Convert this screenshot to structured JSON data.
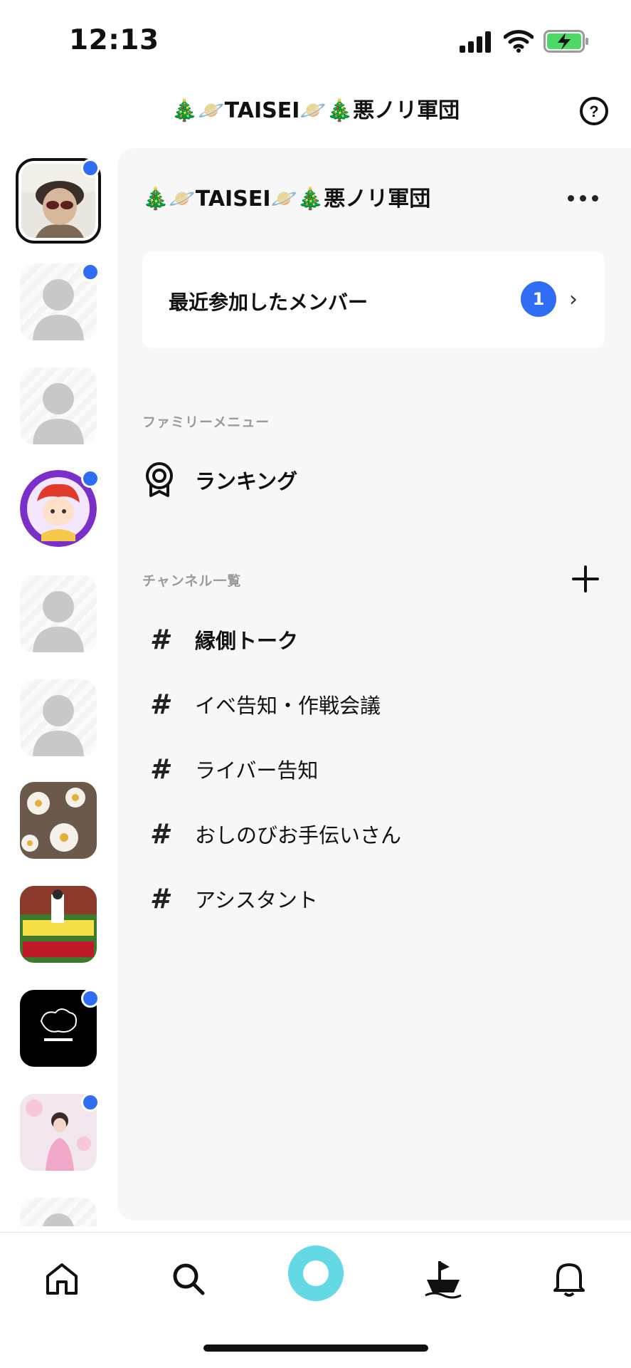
{
  "status_bar": {
    "time": "12:13"
  },
  "header": {
    "title": "🎄🪐TAISEI🪐🎄悪ノリ軍団"
  },
  "community": {
    "title": "🎄🪐TAISEI🪐🎄悪ノリ軍団"
  },
  "recent_members": {
    "label": "最近参加したメンバー",
    "count": "1"
  },
  "family_menu": {
    "section_label": "ファミリーメニュー",
    "items": [
      {
        "label": "ランキング",
        "icon": "ranking-medal-icon"
      }
    ]
  },
  "channels": {
    "section_label": "チャンネル一覧",
    "items": [
      {
        "label": "縁側トーク",
        "bold": true
      },
      {
        "label": "イベ告知・作戦会議",
        "bold": false
      },
      {
        "label": "ライバー告知",
        "bold": false
      },
      {
        "label": "おしのびお手伝いさん",
        "bold": false
      },
      {
        "label": "アシスタント",
        "bold": false
      }
    ]
  },
  "rail": {
    "items": [
      {
        "type": "avatar-photo",
        "unread": true,
        "selected": true
      },
      {
        "type": "placeholder",
        "unread": true
      },
      {
        "type": "placeholder",
        "unread": false
      },
      {
        "type": "illustration",
        "unread": true
      },
      {
        "type": "placeholder",
        "unread": false
      },
      {
        "type": "placeholder",
        "unread": false
      },
      {
        "type": "flowers",
        "unread": false
      },
      {
        "type": "urawa",
        "unread": false
      },
      {
        "type": "black-logo",
        "unread": true
      },
      {
        "type": "portrait",
        "unread": true
      },
      {
        "type": "placeholder",
        "unread": false
      }
    ]
  },
  "bottom_nav": [
    "home-icon",
    "search-icon",
    "center-action-icon",
    "ship-icon",
    "bell-icon"
  ],
  "colors": {
    "accent_blue": "#2f6df5",
    "center_button": "#63d9e6",
    "panel_bg": "#f7f7f7"
  }
}
